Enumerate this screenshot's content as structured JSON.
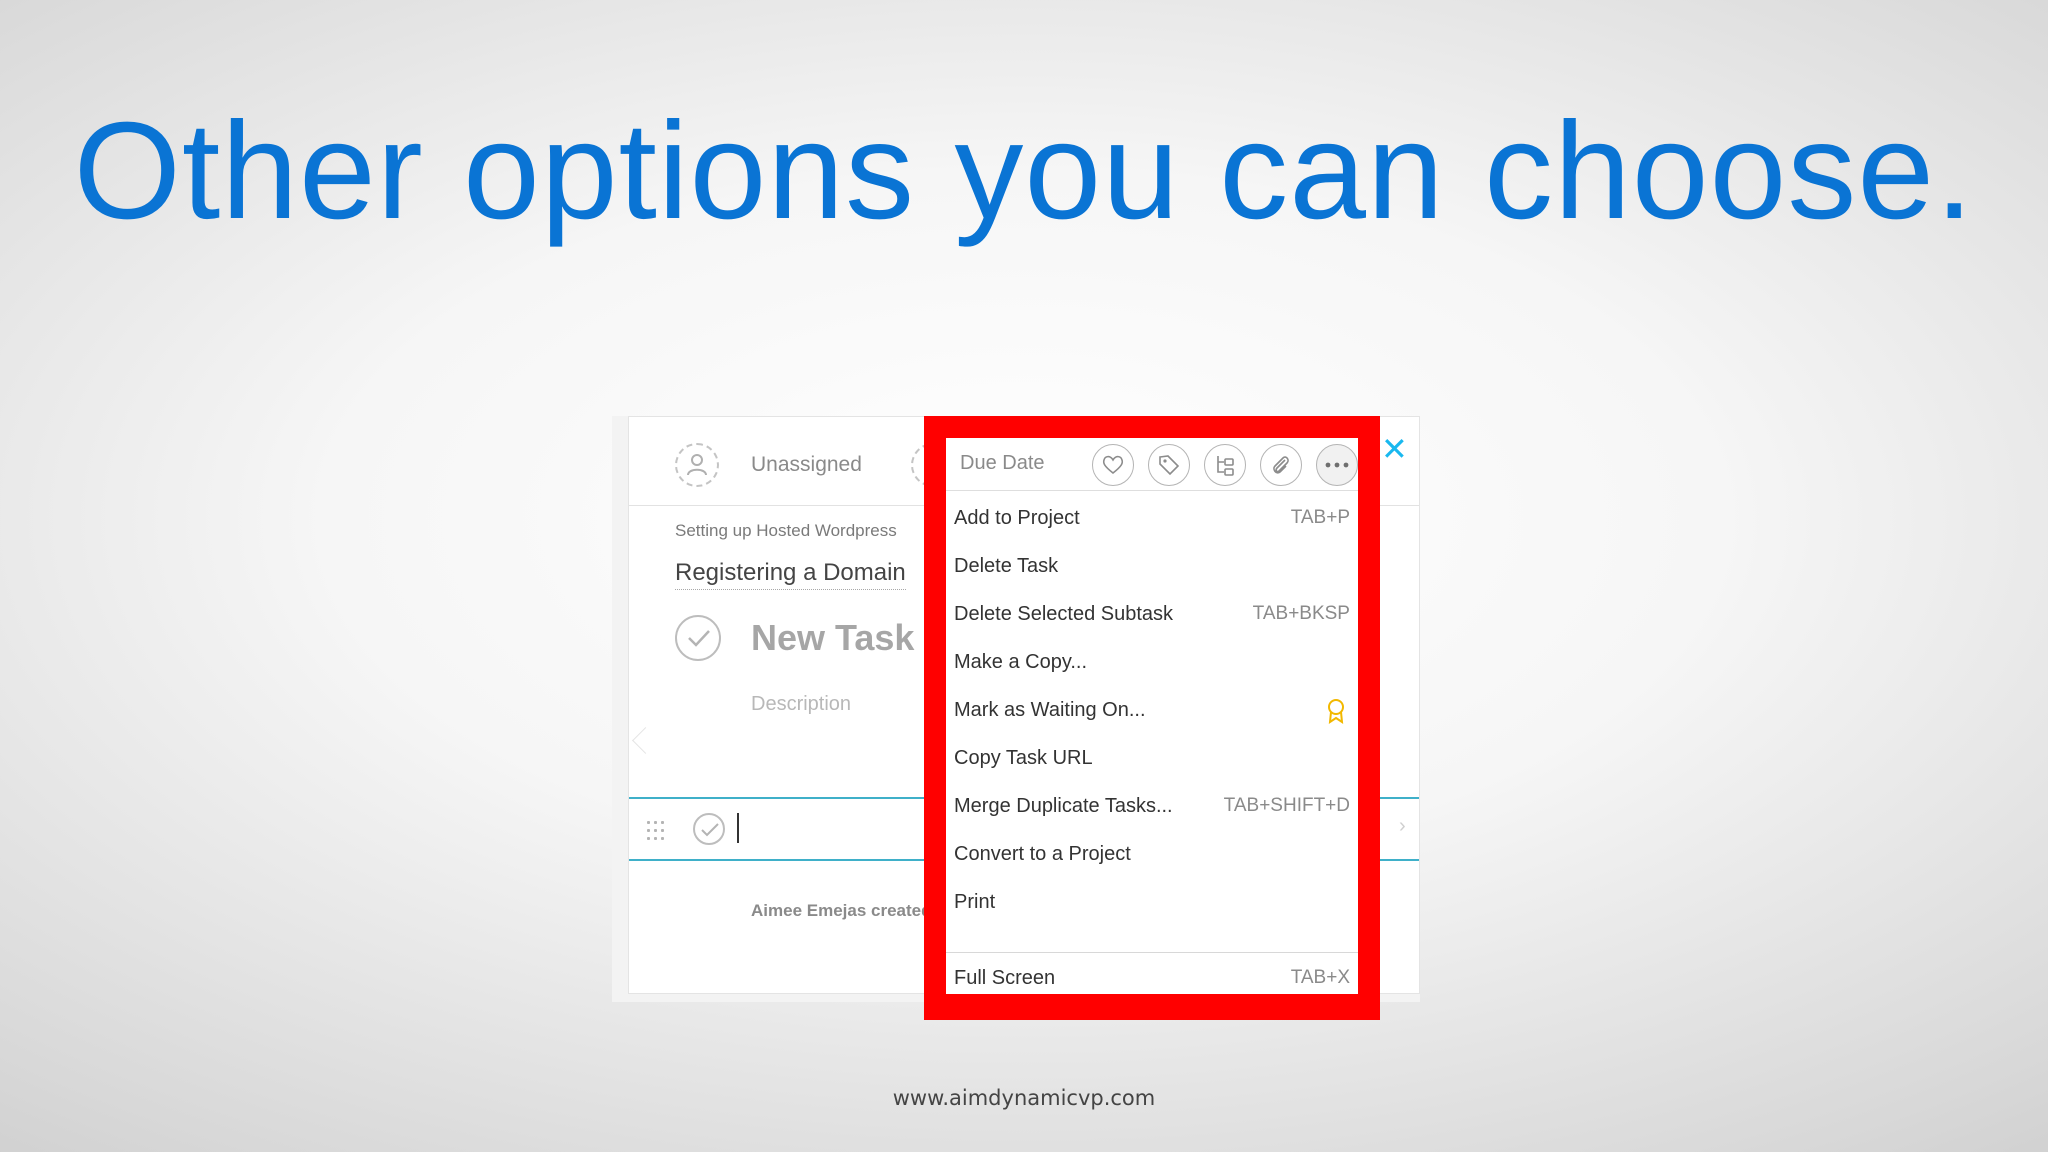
{
  "slide": {
    "title": "Other options you can choose.",
    "footer_url": "www.aimdynamicvp.com"
  },
  "task_panel": {
    "assignee": "Unassigned",
    "breadcrumb": "Setting up Hosted Wordpress",
    "parent_task": "Registering a Domain",
    "task_name": "New Task",
    "description_placeholder": "Description",
    "activity": "Aimee Emejas created"
  },
  "menu": {
    "due_date": "Due Date",
    "toolbar_icons": [
      "heart-icon",
      "tag-icon",
      "subtask-icon",
      "paperclip-icon",
      "more-options-icon"
    ],
    "items": [
      {
        "label": "Add to Project",
        "shortcut": "TAB+P"
      },
      {
        "label": "Delete Task",
        "shortcut": ""
      },
      {
        "label": "Delete Selected Subtask",
        "shortcut": "TAB+BKSP"
      },
      {
        "label": "Make a Copy...",
        "shortcut": ""
      },
      {
        "label": "Mark as Waiting On...",
        "shortcut": ""
      },
      {
        "label": "Copy Task URL",
        "shortcut": ""
      },
      {
        "label": "Merge Duplicate Tasks...",
        "shortcut": "TAB+SHIFT+D"
      },
      {
        "label": "Convert to a Project",
        "shortcut": ""
      },
      {
        "label": "Print",
        "shortcut": ""
      }
    ],
    "footer_item": {
      "label": "Full Screen",
      "shortcut": "TAB+X"
    }
  },
  "colors": {
    "title_blue": "#0a74d4",
    "highlight_red": "#ff0000",
    "close_blue": "#19b8ef",
    "subtask_border": "#3fb0c9",
    "premium_gold": "#f2b800"
  }
}
